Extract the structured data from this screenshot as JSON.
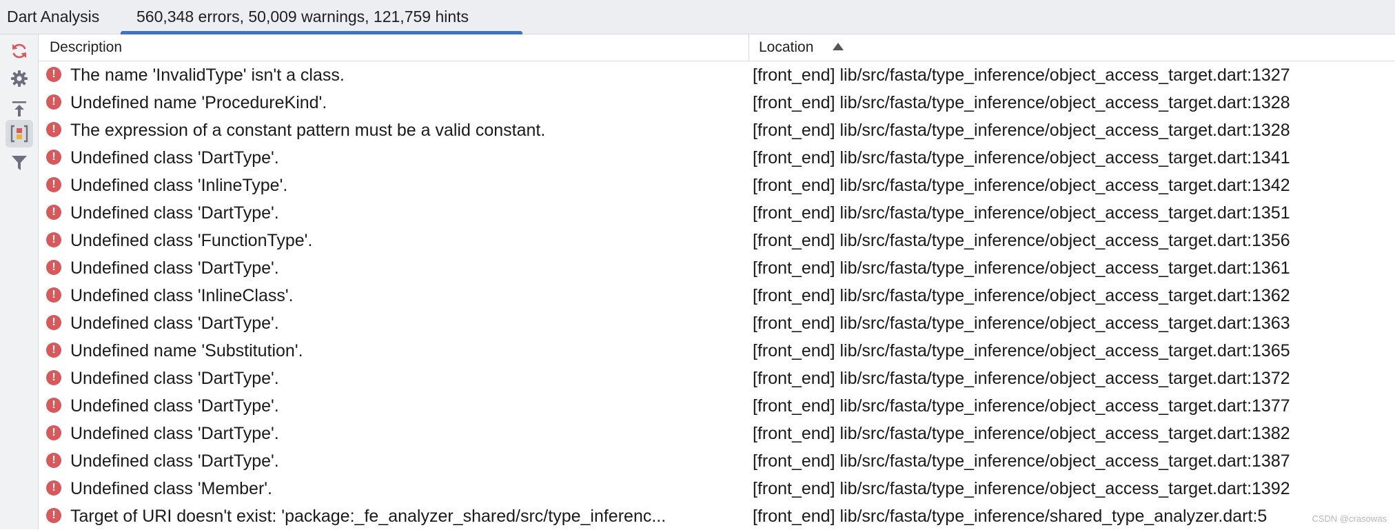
{
  "tool_window": {
    "title": "Dart Analysis"
  },
  "tab": {
    "label": "560,348 errors, 50,009 warnings, 121,759 hints"
  },
  "sidebar": {
    "buttons": [
      {
        "name": "refresh",
        "icon": "refresh-icon"
      },
      {
        "name": "settings",
        "icon": "gear-icon"
      },
      {
        "name": "autoscroll",
        "icon": "autoscroll-to-source-icon"
      },
      {
        "name": "group-by-file",
        "icon": "group-by-file-icon",
        "active": true
      },
      {
        "name": "filter",
        "icon": "filter-icon"
      }
    ]
  },
  "table": {
    "columns": {
      "description": "Description",
      "location": "Location"
    },
    "sort": {
      "column": "location",
      "direction": "ascending"
    },
    "rows": [
      {
        "severity": "error",
        "description": "The name 'InvalidType' isn't a class.",
        "location": "[front_end] lib/src/fasta/type_inference/object_access_target.dart:1327"
      },
      {
        "severity": "error",
        "description": "Undefined name 'ProcedureKind'.",
        "location": "[front_end] lib/src/fasta/type_inference/object_access_target.dart:1328"
      },
      {
        "severity": "error",
        "description": "The expression of a constant pattern must be a valid constant.",
        "location": "[front_end] lib/src/fasta/type_inference/object_access_target.dart:1328"
      },
      {
        "severity": "error",
        "description": "Undefined class 'DartType'.",
        "location": "[front_end] lib/src/fasta/type_inference/object_access_target.dart:1341"
      },
      {
        "severity": "error",
        "description": "Undefined class 'InlineType'.",
        "location": "[front_end] lib/src/fasta/type_inference/object_access_target.dart:1342"
      },
      {
        "severity": "error",
        "description": "Undefined class 'DartType'.",
        "location": "[front_end] lib/src/fasta/type_inference/object_access_target.dart:1351"
      },
      {
        "severity": "error",
        "description": "Undefined class 'FunctionType'.",
        "location": "[front_end] lib/src/fasta/type_inference/object_access_target.dart:1356"
      },
      {
        "severity": "error",
        "description": "Undefined class 'DartType'.",
        "location": "[front_end] lib/src/fasta/type_inference/object_access_target.dart:1361"
      },
      {
        "severity": "error",
        "description": "Undefined class 'InlineClass'.",
        "location": "[front_end] lib/src/fasta/type_inference/object_access_target.dart:1362"
      },
      {
        "severity": "error",
        "description": "Undefined class 'DartType'.",
        "location": "[front_end] lib/src/fasta/type_inference/object_access_target.dart:1363"
      },
      {
        "severity": "error",
        "description": "Undefined name 'Substitution'.",
        "location": "[front_end] lib/src/fasta/type_inference/object_access_target.dart:1365"
      },
      {
        "severity": "error",
        "description": "Undefined class 'DartType'.",
        "location": "[front_end] lib/src/fasta/type_inference/object_access_target.dart:1372"
      },
      {
        "severity": "error",
        "description": "Undefined class 'DartType'.",
        "location": "[front_end] lib/src/fasta/type_inference/object_access_target.dart:1377"
      },
      {
        "severity": "error",
        "description": "Undefined class 'DartType'.",
        "location": "[front_end] lib/src/fasta/type_inference/object_access_target.dart:1382"
      },
      {
        "severity": "error",
        "description": "Undefined class 'DartType'.",
        "location": "[front_end] lib/src/fasta/type_inference/object_access_target.dart:1387"
      },
      {
        "severity": "error",
        "description": "Undefined class 'Member'.",
        "location": "[front_end] lib/src/fasta/type_inference/object_access_target.dart:1392"
      },
      {
        "severity": "error",
        "description": "Target of URI doesn't exist: 'package:_fe_analyzer_shared/src/type_inferenc...",
        "location": "[front_end] lib/src/fasta/type_inference/shared_type_analyzer.dart:5"
      }
    ]
  },
  "watermark": "CSDN @crasowas",
  "colors": {
    "error": "#d9595b",
    "tab_underline": "#3d74c6",
    "refresh": "#d9595b"
  }
}
